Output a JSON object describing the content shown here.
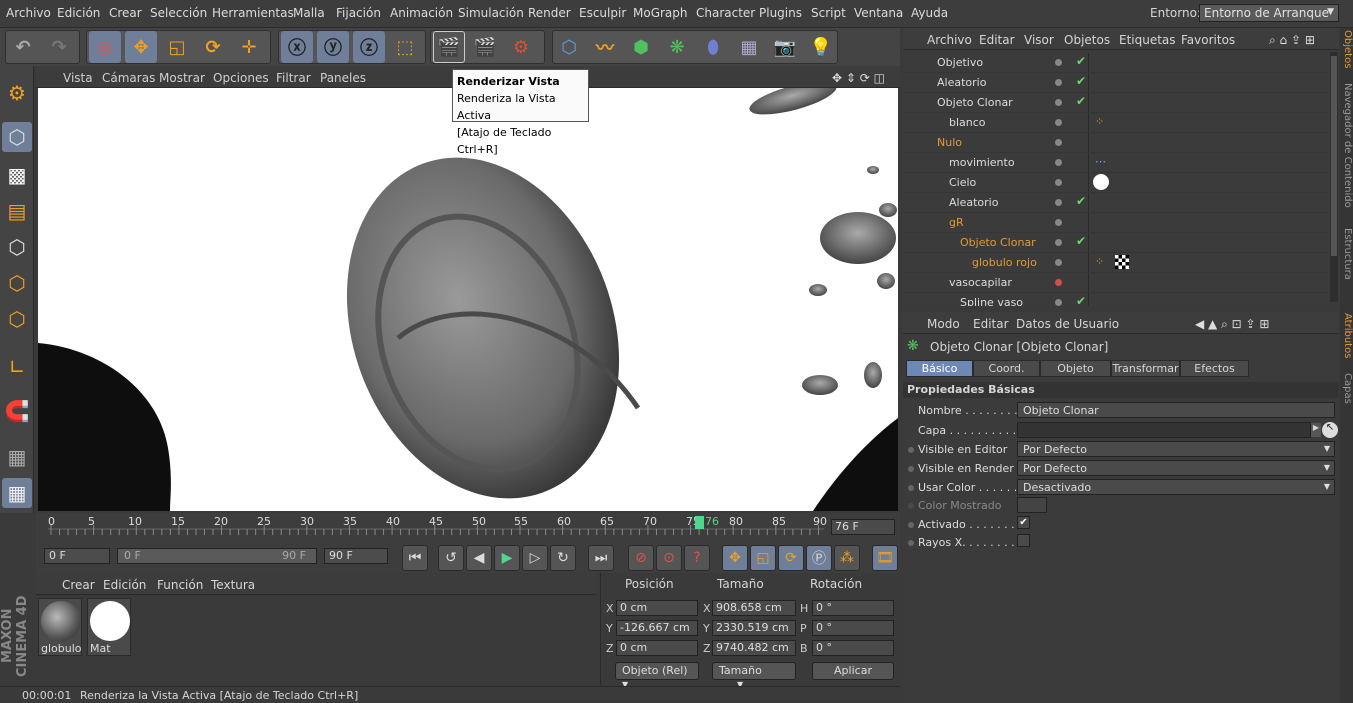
{
  "menu": [
    "Archivo",
    "Edición",
    "Crear",
    "Selección",
    "Herramientas",
    "Malla",
    "Fijación",
    "Animación",
    "Simulación",
    "Render",
    "Esculpir",
    "MoGraph",
    "Character",
    "Plugins",
    "Script",
    "Ventana",
    "Ayuda"
  ],
  "layout": {
    "label": "Entorno:",
    "value": "Entorno de Arranque"
  },
  "viewport_menu": [
    "Vista",
    "Cámaras",
    "Mostrar",
    "Opciones",
    "Filtrar",
    "Paneles"
  ],
  "tooltip": {
    "title": "Renderizar Vista",
    "desc": "Renderiza la Vista Activa",
    "shortcut": "[Atajo de Teclado Ctrl+R]"
  },
  "timeline": {
    "ticks": [
      "0",
      "5",
      "10",
      "15",
      "20",
      "25",
      "30",
      "35",
      "40",
      "45",
      "50",
      "55",
      "60",
      "65",
      "70",
      "75",
      "80",
      "85",
      "90"
    ],
    "current_label": "76",
    "current_frame": 76,
    "frame_field": "76 F"
  },
  "transport": {
    "start": "0 F",
    "range_start": "0 F",
    "range_end": "90 F",
    "end": "90 F"
  },
  "material_menu": [
    "Crear",
    "Edición",
    "Función",
    "Textura"
  ],
  "materials": [
    {
      "name": "globulo"
    },
    {
      "name": "Mat"
    }
  ],
  "coords": {
    "headers": [
      "Posición",
      "Tamaño",
      "Rotación"
    ],
    "rows": [
      {
        "axis": "X",
        "pos": "0 cm",
        "saxis": "X",
        "size": "908.658 cm",
        "raxis": "H",
        "rot": "0 °"
      },
      {
        "axis": "Y",
        "pos": "-126.667 cm",
        "saxis": "Y",
        "size": "2330.519 cm",
        "raxis": "P",
        "rot": "0 °"
      },
      {
        "axis": "Z",
        "pos": "0 cm",
        "saxis": "Z",
        "size": "9740.482 cm",
        "raxis": "B",
        "rot": "0 °"
      }
    ],
    "mode": "Objeto (Rel)",
    "size_mode": "Tamaño",
    "apply": "Aplicar"
  },
  "status": {
    "time": "00:00:01",
    "text": "Renderiza la Vista Activa [Atajo de Teclado Ctrl+R]"
  },
  "object_menu": [
    "Archivo",
    "Editar",
    "Visor",
    "Objetos",
    "Etiquetas",
    "Favoritos"
  ],
  "objects": [
    {
      "name": "Objetivo",
      "orange": false,
      "check": true
    },
    {
      "name": "Aleatorio",
      "orange": false,
      "check": true
    },
    {
      "name": "Objeto Clonar",
      "orange": false,
      "check": true
    },
    {
      "name": "blanco",
      "orange": false,
      "check": false
    },
    {
      "name": "Nulo",
      "orange": true,
      "check": false
    },
    {
      "name": "movimiento",
      "orange": false,
      "check": false
    },
    {
      "name": "Cielo",
      "orange": false,
      "check": false
    },
    {
      "name": "Aleatorio",
      "orange": false,
      "check": true
    },
    {
      "name": "gR",
      "orange": true,
      "check": false
    },
    {
      "name": "Objeto Clonar",
      "orange": true,
      "check": true
    },
    {
      "name": "globulo rojo",
      "orange": true,
      "check": false
    },
    {
      "name": "vasocapilar",
      "orange": false,
      "check": false
    },
    {
      "name": "Spline vaso",
      "orange": false,
      "check": true
    }
  ],
  "attr_menu": [
    "Modo",
    "Editar",
    "Datos de Usuario"
  ],
  "attr": {
    "title": "Objeto Clonar [Objeto Clonar]",
    "tabs": [
      "Básico",
      "Coord.",
      "Objeto",
      "Transformar",
      "Efectos"
    ],
    "section": "Propiedades Básicas",
    "props": [
      {
        "label": "Nombre . . . . . . . .",
        "value": "Objeto Clonar"
      },
      {
        "label": "Capa . . . . . . . . . . .",
        "value": ""
      },
      {
        "label": "Visible en Editor",
        "value": "Por Defecto"
      },
      {
        "label": "Visible en Render",
        "value": "Por Defecto"
      },
      {
        "label": "Usar Color . . . . . . .",
        "value": "Desactivado"
      },
      {
        "label": "Color Mostrado",
        "value": ""
      },
      {
        "label": "Activado . . . . . . . .",
        "value": "✔"
      },
      {
        "label": "Rayos X. . . . . . . . . .",
        "value": ""
      }
    ]
  },
  "right_tabs": [
    "Objetos",
    "Navegador de Contenido",
    "Estructura",
    "Atributos",
    "Capas"
  ],
  "brand": "MAXON CINEMA 4D",
  "colors": {
    "accent": "#6e88b6",
    "orange": "#e09a3a",
    "check": "#6fd66f"
  }
}
